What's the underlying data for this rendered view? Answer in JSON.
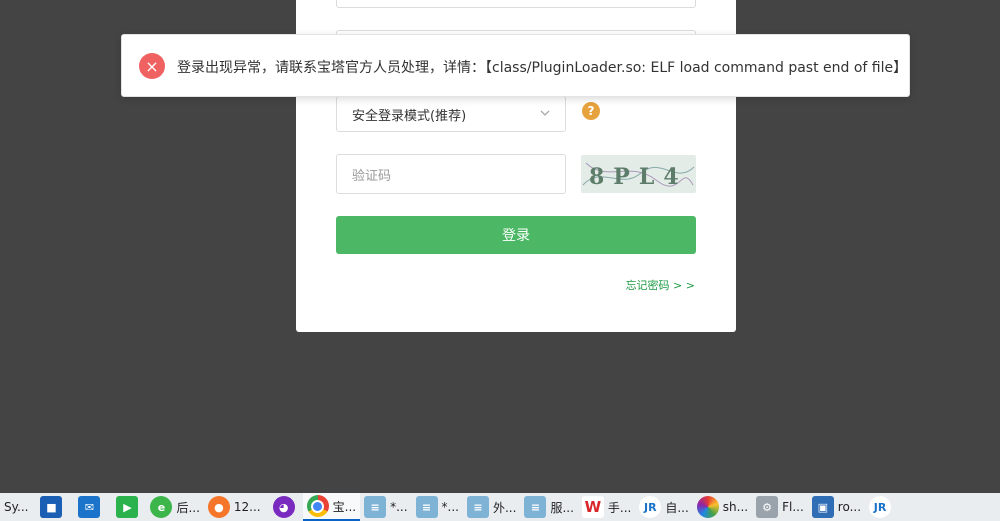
{
  "login": {
    "mode_select_value": "安全登录模式(推荐)",
    "help_icon": "?",
    "captcha_placeholder": "验证码",
    "captcha_text": "8PL4",
    "login_button": "登录",
    "forgot_link": "忘记密码 > >"
  },
  "toast": {
    "message": "登录出现异常，请联系宝塔官方人员处理，详情：【class/PluginLoader.so: ELF load command past end of file】",
    "icon": "×"
  },
  "taskbar": {
    "items": [
      {
        "label": "Sy...",
        "icon": "app-icon"
      },
      {
        "label": "",
        "icon": "store-icon"
      },
      {
        "label": "",
        "icon": "mail-icon"
      },
      {
        "label": "",
        "icon": "media-player-icon"
      },
      {
        "label": "后...",
        "icon": "ie-browser-icon"
      },
      {
        "label": "12...",
        "icon": "firefox-icon"
      },
      {
        "label": "",
        "icon": "mask-app-icon"
      },
      {
        "label": "宝...",
        "icon": "chrome-icon"
      },
      {
        "label": "*...",
        "icon": "notepad-icon"
      },
      {
        "label": "*...",
        "icon": "notepad-icon"
      },
      {
        "label": "外...",
        "icon": "notepad-icon"
      },
      {
        "label": "服...",
        "icon": "notepad-icon"
      },
      {
        "label": "手...",
        "icon": "wps-icon"
      },
      {
        "label": "自...",
        "icon": "jr-app-icon"
      },
      {
        "label": "sh...",
        "icon": "color-wheel-icon"
      },
      {
        "label": "Fl...",
        "icon": "flash-tool-icon"
      },
      {
        "label": "ro...",
        "icon": "remote-desktop-icon"
      },
      {
        "label": "",
        "icon": "jr-app-icon"
      }
    ]
  },
  "colors": {
    "background": "#444444",
    "accent_green": "#4cb865",
    "error_red": "#f06262",
    "warning_orange": "#e6a23c"
  }
}
